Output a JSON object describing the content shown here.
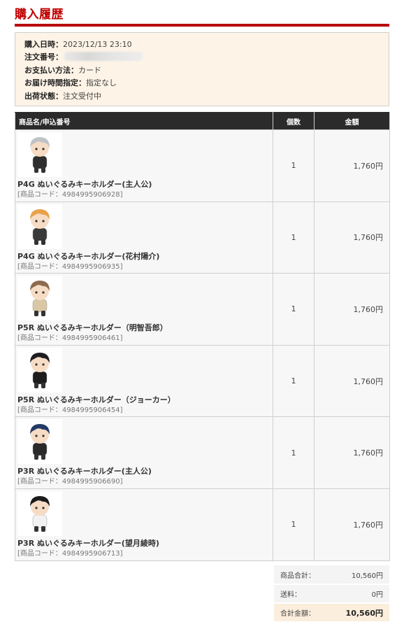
{
  "page": {
    "title": "購入履歴"
  },
  "order": {
    "date_label": "購入日時：",
    "date_value": "2023/12/13 23:10",
    "number_label": "注文番号：",
    "payment_label": "お支払い方法：",
    "payment_value": "カード",
    "delivery_label": "お届け時間指定：",
    "delivery_value": "指定なし",
    "shipping_label": "出荷状態：",
    "shipping_value": "注文受付中"
  },
  "table": {
    "headers": {
      "name": "商品名/申込番号",
      "qty": "個数",
      "price": "金額"
    },
    "items": [
      {
        "name": "P4G ぬいぐるみキーホルダー(主人公)",
        "code": "[商品コード：4984995906928]",
        "qty": "1",
        "price": "1,760円",
        "hair": "#bfc3c8",
        "outfit": "#2e2e2e"
      },
      {
        "name": "P4G ぬいぐるみキーホルダー(花村陽介)",
        "code": "[商品コード：4984995906935]",
        "qty": "1",
        "price": "1,760円",
        "hair": "#e8a24a",
        "outfit": "#3a3a3a"
      },
      {
        "name": "P5R ぬいぐるみキーホルダー（明智吾郎）",
        "code": "[商品コード：4984995906461]",
        "qty": "1",
        "price": "1,760円",
        "hair": "#8d6a4f",
        "outfit": "#d9c7a6"
      },
      {
        "name": "P5R ぬいぐるみキーホルダー（ジョーカー）",
        "code": "[商品コード：4984995906454]",
        "qty": "1",
        "price": "1,760円",
        "hair": "#1d1d22",
        "outfit": "#1d1d1d"
      },
      {
        "name": "P3R ぬいぐるみキーホルダー(主人公)",
        "code": "[商品コード：4984995906690]",
        "qty": "1",
        "price": "1,760円",
        "hair": "#243a66",
        "outfit": "#2a2a2a"
      },
      {
        "name": "P3R ぬいぐるみキーホルダー(望月綾時)",
        "code": "[商品コード：4984995906713]",
        "qty": "1",
        "price": "1,760円",
        "hair": "#1b1b1b",
        "outfit": "#f2f2f2"
      }
    ]
  },
  "totals": {
    "subtotal_label": "商品合計：",
    "subtotal_value": "10,560円",
    "shipping_label": "送料：",
    "shipping_value": "0円",
    "grand_label": "合計金額：",
    "grand_value": "10,560円"
  },
  "colors": {
    "accent": "#c00000",
    "header_bg": "#2b2b2b",
    "info_bg": "#fdf3e6"
  }
}
